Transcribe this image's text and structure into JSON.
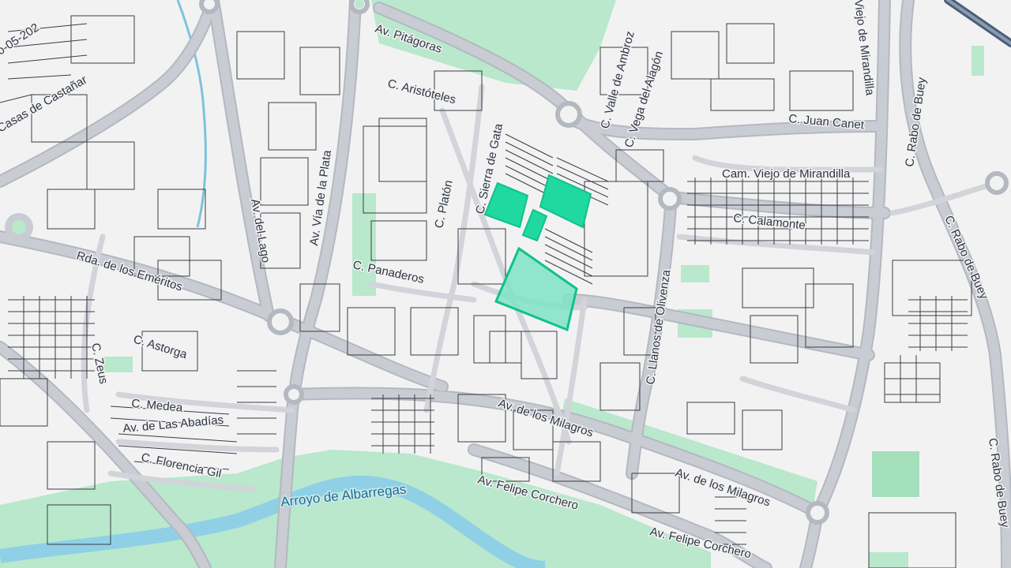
{
  "map": {
    "colors": {
      "background": "#f3f2f3",
      "road": "#c9ccd3",
      "road_outline": "#b4b8c0",
      "block_line": "#3a3d42",
      "park": "#b9e8cc",
      "park_dark": "#a4dfbc",
      "water": "#8fd0e6",
      "river": "#7cc3de",
      "highlight_fill": "#20d9a0",
      "highlight_stroke": "#0ec28b",
      "highway": "#4a5f7a"
    },
    "streets": [
      {
        "id": "av-pitagoras",
        "text": "Av. Pitágoras"
      },
      {
        "id": "c-aristoteles",
        "text": "C. Aristóteles"
      },
      {
        "id": "c-sierra-de-gata",
        "text": "C. Sierra de Gata"
      },
      {
        "id": "c-platon",
        "text": "C. Platón"
      },
      {
        "id": "c-panaderos",
        "text": "C. Panaderos"
      },
      {
        "id": "av-via-de-la-plata",
        "text": "Av. Vía de la Plata"
      },
      {
        "id": "av-del-lago",
        "text": "Av. del Lago"
      },
      {
        "id": "rda-emeritos",
        "text": "Rda. de los Eméritos"
      },
      {
        "id": "c-astorga",
        "text": "C. Astorga"
      },
      {
        "id": "c-zeus",
        "text": "C. Zeus"
      },
      {
        "id": "c-medea",
        "text": "C. Medea"
      },
      {
        "id": "av-abadias",
        "text": "Av. de Las Abadías"
      },
      {
        "id": "c-florencia-gil",
        "text": "C. Florencia Gil"
      },
      {
        "id": "casas-castanar",
        "text": "Casas de Castañar"
      },
      {
        "id": "date-fragment",
        "text": "o-05-202"
      },
      {
        "id": "arroyo-albarregas",
        "text": "Arroyo de Albarregas"
      },
      {
        "id": "av-felipe-corchero-1",
        "text": "Av. Felipe Corchero"
      },
      {
        "id": "av-felipe-corchero-2",
        "text": "Av. Felipe Corchero"
      },
      {
        "id": "av-milagros-1",
        "text": "Av. de los Milagros"
      },
      {
        "id": "av-milagros-2",
        "text": "Av. de los Milagros"
      },
      {
        "id": "c-llanos-olivenza",
        "text": "C. Llanos de Olivenza"
      },
      {
        "id": "c-calamonte",
        "text": "C. Calamonte"
      },
      {
        "id": "cam-viejo-mirandilla",
        "text": "Cam. Viejo de Mirandilla"
      },
      {
        "id": "c-juan-canet",
        "text": "C. Juan Canet"
      },
      {
        "id": "c-valle-ambroz",
        "text": "C. Valle de Ambroz"
      },
      {
        "id": "c-vega-alagon",
        "text": "C. Vega del Alagón"
      },
      {
        "id": "viejo-mirandilla",
        "text": "Viejo de Mirandilla"
      },
      {
        "id": "c-rabo-buey-1",
        "text": "C. Rabo de Buey"
      },
      {
        "id": "c-rabo-buey-2",
        "text": "C. Rabo de Buey"
      },
      {
        "id": "c-rabo-buey-3",
        "text": "C. Rabo de Buey"
      }
    ]
  }
}
